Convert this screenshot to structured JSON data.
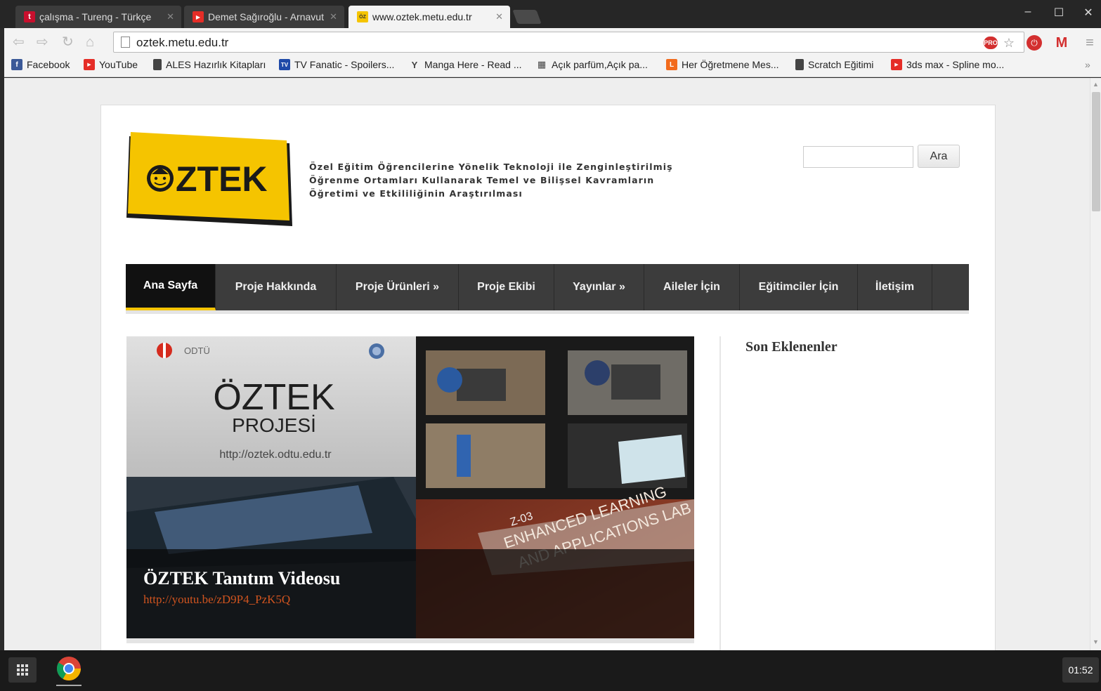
{
  "tabs": [
    {
      "title": "çalışma - Tureng - Türkçe",
      "favicon": "tureng-icon",
      "favicon_color": "#c8102e"
    },
    {
      "title": "Demet Sağıroğlu - Arnavut",
      "favicon": "youtube-icon",
      "favicon_color": "#e52d27"
    },
    {
      "title": "www.oztek.metu.edu.tr",
      "favicon": "oztek-icon",
      "favicon_color": "#f5c400"
    }
  ],
  "window_controls": {
    "minimize": "‒",
    "maximize": "☐",
    "close": "✕"
  },
  "toolbar": {
    "url": "oztek.metu.edu.tr",
    "pro_badge": "PRO"
  },
  "bookmarks": [
    {
      "label": "Facebook",
      "icon": "facebook-icon",
      "color": "#3b5998"
    },
    {
      "label": "YouTube",
      "icon": "youtube-icon",
      "color": "#e52d27"
    },
    {
      "label": "ALES Hazırlık Kitapları",
      "icon": "page-icon",
      "color": "#555"
    },
    {
      "label": "TV Fanatic - Spoilers...",
      "icon": "tvfanatic-icon",
      "color": "#1f4aa8"
    },
    {
      "label": "Manga Here - Read ...",
      "icon": "mangahere-icon",
      "color": "#555"
    },
    {
      "label": "Açık parfüm,Açık pa...",
      "icon": "shop-icon",
      "color": "#555"
    },
    {
      "label": "Her Öğretmene Mes...",
      "icon": "ogretmen-icon",
      "color": "#f26b1d"
    },
    {
      "label": "Scratch Eğitimi",
      "icon": "page-icon",
      "color": "#555"
    },
    {
      "label": "3ds max - Spline mo...",
      "icon": "youtube-icon",
      "color": "#e52d27"
    }
  ],
  "bookmarks_overflow": "»",
  "site": {
    "logo_text": "ÖZTEK",
    "tagline": [
      "Özel Eğitim Öğrencilerine Yönelik Teknoloji ile Zenginleştirilmiş",
      "Öğrenme Ortamları Kullanarak Temel ve Bilişsel Kavramların",
      "Öğretimi ve Etkililiğinin Araştırılması"
    ],
    "search_button": "Ara",
    "search_value": "",
    "menu": [
      {
        "label": "Ana Sayfa",
        "active": true
      },
      {
        "label": "Proje Hakkında",
        "active": false
      },
      {
        "label": "Proje Ürünleri »",
        "active": false
      },
      {
        "label": "Proje Ekibi",
        "active": false
      },
      {
        "label": "Yayınlar »",
        "active": false
      },
      {
        "label": "Aileler İçin",
        "active": false
      },
      {
        "label": "Eğitimciler İçin",
        "active": false
      },
      {
        "label": "İletişim",
        "active": false
      }
    ],
    "slider": {
      "odtu_label": "ODTÜ",
      "big_title": "ÖZTEK",
      "subtitle": "PROJESİ",
      "url": "http://oztek.odtu.edu.tr",
      "lab_text_1": "ENHANCED LEARNING",
      "lab_text_2": "AND APPLICATIONS LAB",
      "lab_number": "Z-03",
      "caption_title": "ÖZTEK Tanıtım Videosu",
      "caption_link": "http://youtu.be/zD9P4_PzK5Q"
    },
    "sidebar_title": "Son Eklenenler"
  },
  "taskbar": {
    "clock": "01:52"
  },
  "colors": {
    "brand_yellow": "#f5c400",
    "menu_bg": "#3c3c3c",
    "link_orange": "#d0541f"
  }
}
